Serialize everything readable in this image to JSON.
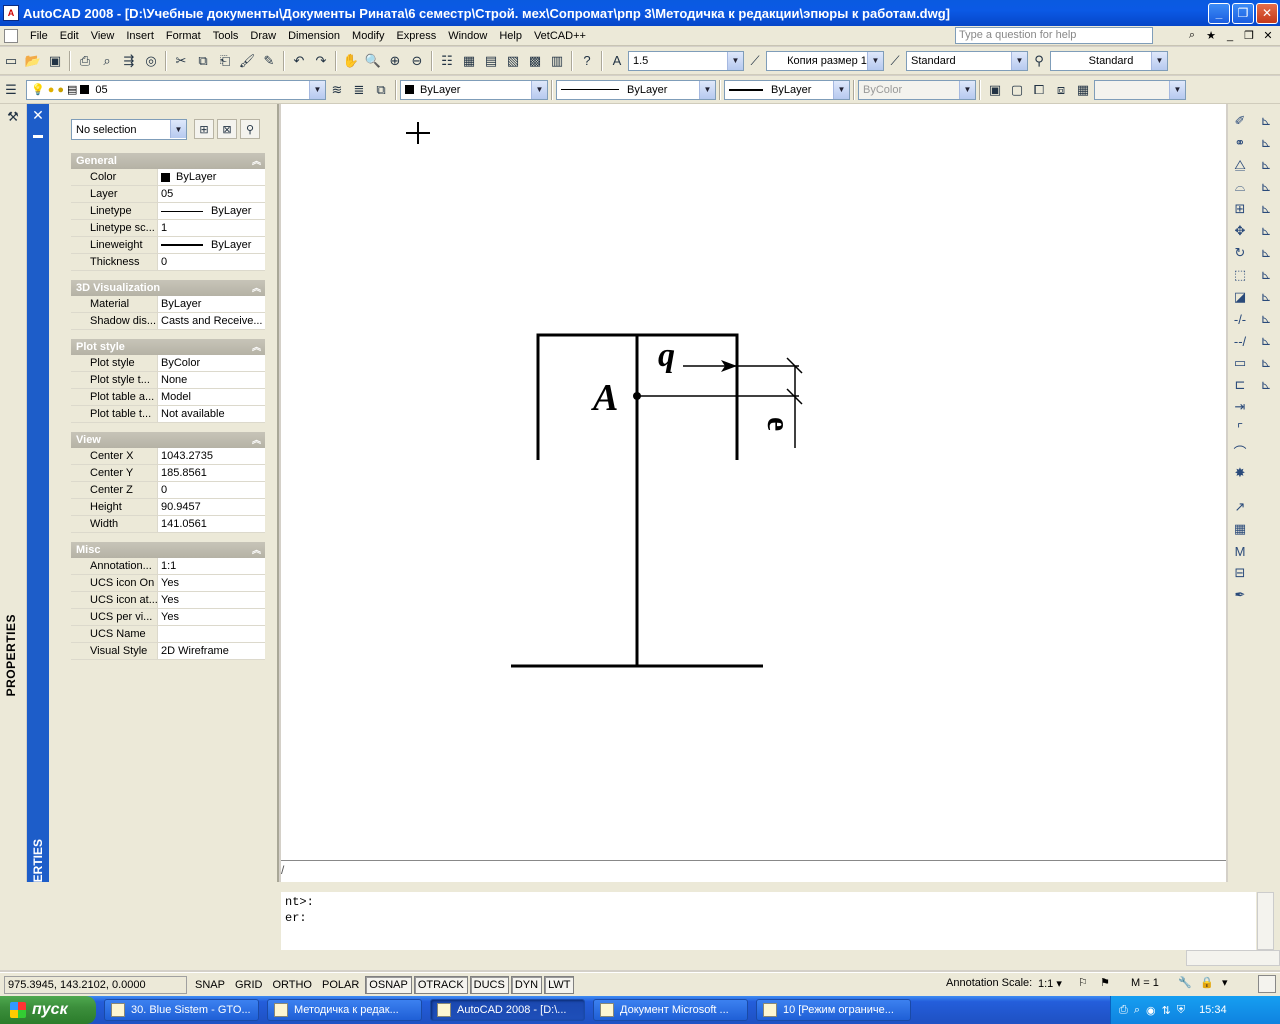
{
  "window": {
    "title": "AutoCAD 2008 - [D:\\Учебные документы\\Документы Рината\\6 семестр\\Строй. мех\\Сопромат\\рпр 3\\Методичка к редакции\\эпюры к работам.dwg]",
    "minimize_glyph": "_",
    "restore_glyph": "❐",
    "close_glyph": "✕"
  },
  "menu": {
    "items": [
      "File",
      "Edit",
      "View",
      "Insert",
      "Format",
      "Tools",
      "Draw",
      "Dimension",
      "Modify",
      "Express",
      "Window",
      "Help",
      "VetCAD++"
    ],
    "help_placeholder": "Type a question for help"
  },
  "toolbar1": {
    "text_height": "1.5",
    "dim_style": "Копия размер 1",
    "text_style": "Standard",
    "table_style": "Standard"
  },
  "toolbar2": {
    "layer": "05",
    "color": "ByLayer",
    "linetype": "ByLayer",
    "lineweight": "ByLayer",
    "plot_style": "ByColor"
  },
  "palette": {
    "side_label": "PROPERTIES",
    "selection": "No selection",
    "sections": {
      "general": {
        "title": "General",
        "rows": [
          {
            "name": "Color",
            "value": "ByLayer"
          },
          {
            "name": "Layer",
            "value": "05"
          },
          {
            "name": "Linetype",
            "value": "ByLayer"
          },
          {
            "name": "Linetype sc...",
            "value": "1"
          },
          {
            "name": "Lineweight",
            "value": "ByLayer"
          },
          {
            "name": "Thickness",
            "value": "0"
          }
        ]
      },
      "visualization": {
        "title": "3D Visualization",
        "rows": [
          {
            "name": "Material",
            "value": "ByLayer"
          },
          {
            "name": "Shadow dis...",
            "value": "Casts and Receive..."
          }
        ]
      },
      "plot_style": {
        "title": "Plot style",
        "rows": [
          {
            "name": "Plot style",
            "value": "ByColor"
          },
          {
            "name": "Plot style t...",
            "value": "None"
          },
          {
            "name": "Plot table a...",
            "value": "Model"
          },
          {
            "name": "Plot table t...",
            "value": "Not available"
          }
        ]
      },
      "view": {
        "title": "View",
        "rows": [
          {
            "name": "Center X",
            "value": "1043.2735"
          },
          {
            "name": "Center Y",
            "value": "185.8561"
          },
          {
            "name": "Center Z",
            "value": "0"
          },
          {
            "name": "Height",
            "value": "90.9457"
          },
          {
            "name": "Width",
            "value": "141.0561"
          }
        ]
      },
      "misc": {
        "title": "Misc",
        "rows": [
          {
            "name": "Annotation...",
            "value": "1:1"
          },
          {
            "name": "UCS icon On",
            "value": "Yes"
          },
          {
            "name": "UCS icon at...",
            "value": "Yes"
          },
          {
            "name": "UCS per vi...",
            "value": "Yes"
          },
          {
            "name": "UCS Name",
            "value": ""
          },
          {
            "name": "Visual Style",
            "value": "2D Wireframe"
          }
        ]
      }
    }
  },
  "drawing": {
    "label_q": "q",
    "label_A": "A",
    "label_e": "e"
  },
  "command": {
    "line1": "nt>:",
    "line2": "er:"
  },
  "status": {
    "coords": "975.3945, 143.2102, 0.0000",
    "buttons": [
      {
        "label": "SNAP",
        "on": false
      },
      {
        "label": "GRID",
        "on": false
      },
      {
        "label": "ORTHO",
        "on": false
      },
      {
        "label": "POLAR",
        "on": false
      },
      {
        "label": "OSNAP",
        "on": true
      },
      {
        "label": "OTRACK",
        "on": true
      },
      {
        "label": "DUCS",
        "on": true
      },
      {
        "label": "DYN",
        "on": true
      },
      {
        "label": "LWT",
        "on": true
      }
    ],
    "annotation_scale_label": "Annotation Scale:",
    "annotation_scale_value": "1:1 ▾",
    "m_value": "M = 1"
  },
  "taskbar": {
    "start_label": "пуск",
    "tasks": [
      {
        "label": "30. Blue Sistem - GTO...",
        "active": false
      },
      {
        "label": "Методичка к редак...",
        "active": false
      },
      {
        "label": "AutoCAD 2008 - [D:\\...",
        "active": true
      },
      {
        "label": "Документ Microsoft ...",
        "active": false
      },
      {
        "label": "10 [Режим ограниче...",
        "active": false
      }
    ],
    "lang": "EN",
    "clock": "15:34"
  }
}
